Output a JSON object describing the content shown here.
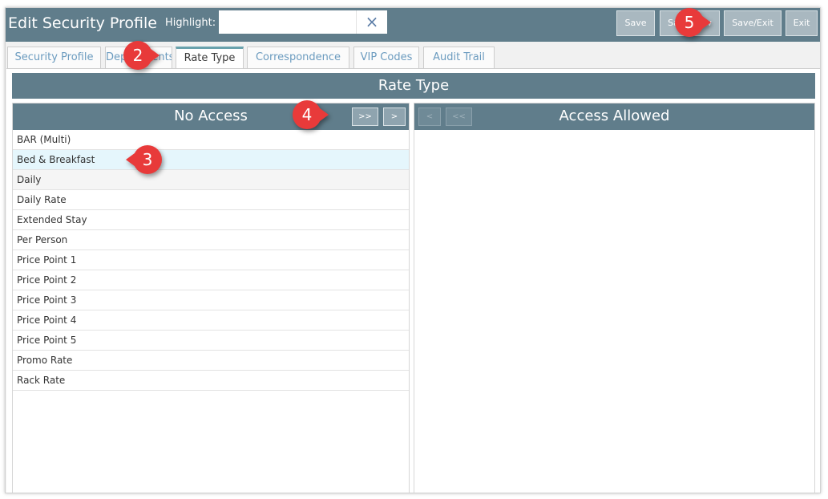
{
  "header": {
    "title": "Edit Security Profile",
    "highlight_label": "Highlight:",
    "highlight_value": "",
    "clear_icon": "×"
  },
  "toolbar": {
    "save": "Save",
    "save_new": "Save/New",
    "save_exit": "Save/Exit",
    "exit": "Exit"
  },
  "tabs": [
    {
      "label": "Security Profile"
    },
    {
      "label": "Departments"
    },
    {
      "label": "Rate Type",
      "active": true
    },
    {
      "label": "Correspondence"
    },
    {
      "label": "VIP Codes"
    },
    {
      "label": "Audit Trail"
    }
  ],
  "section": {
    "title": "Rate Type"
  },
  "no_access": {
    "title": "No Access",
    "move_all_label": ">>",
    "move_one_label": ">",
    "items": [
      "BAR (Multi)",
      "Bed & Breakfast",
      "Daily",
      "Daily Rate",
      "Extended Stay",
      "Per Person",
      "Price Point 1",
      "Price Point 2",
      "Price Point 3",
      "Price Point 4",
      "Price Point 5",
      "Promo Rate",
      "Rack Rate"
    ],
    "selected_item": "Bed & Breakfast"
  },
  "access_allowed": {
    "title": "Access Allowed",
    "move_one_back_label": "<",
    "move_all_back_label": "<<",
    "items": []
  },
  "callouts": {
    "c2": "2",
    "c3": "3",
    "c4": "4",
    "c5": "5"
  },
  "colors": {
    "header_bg": "#607d8b",
    "callout": "#e83a3a",
    "selected_row": "#e5f6fc",
    "tab_link": "#6b9bbf"
  }
}
